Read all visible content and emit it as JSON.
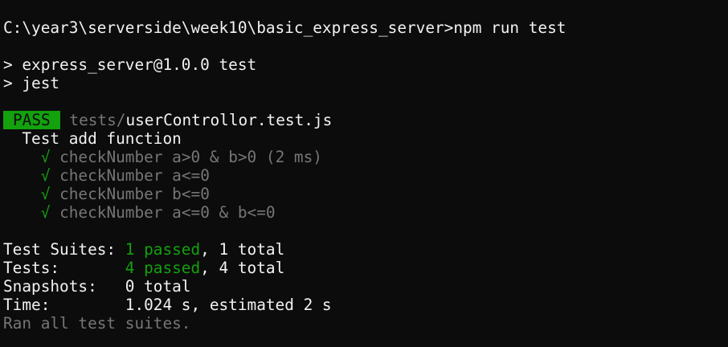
{
  "terminal": {
    "command_line": "C:\\year3\\serverside\\week10\\basic_express_server>npm run test",
    "script_line": "> express_server@1.0.0 test",
    "jest_line": "> jest",
    "result": {
      "badge": "PASS",
      "path_dir": "tests/",
      "path_file": "userControllor.test.js"
    },
    "suite_name": "Test add function",
    "tests": [
      {
        "mark": "√",
        "name": "checkNumber a>0 & b>0 (2 ms)"
      },
      {
        "mark": "√",
        "name": "checkNumber a<=0"
      },
      {
        "mark": "√",
        "name": "checkNumber b<=0"
      },
      {
        "mark": "√",
        "name": "checkNumber a<=0 & b<=0"
      }
    ],
    "summary": {
      "suites_label": "Test Suites: ",
      "suites_passed": "1 passed",
      "suites_total": ", 1 total",
      "tests_label": "Tests:       ",
      "tests_passed": "4 passed",
      "tests_total": ", 4 total",
      "snapshots_label": "Snapshots:   ",
      "snapshots_value": "0 total",
      "time_label": "Time:        ",
      "time_value": "1.024 s, estimated 2 s"
    },
    "footer": "Ran all test suites."
  },
  "colors": {
    "background": "#0c0c0c",
    "foreground": "#f2f2f2",
    "dim": "#767676",
    "pass_green": "#13a10e"
  }
}
